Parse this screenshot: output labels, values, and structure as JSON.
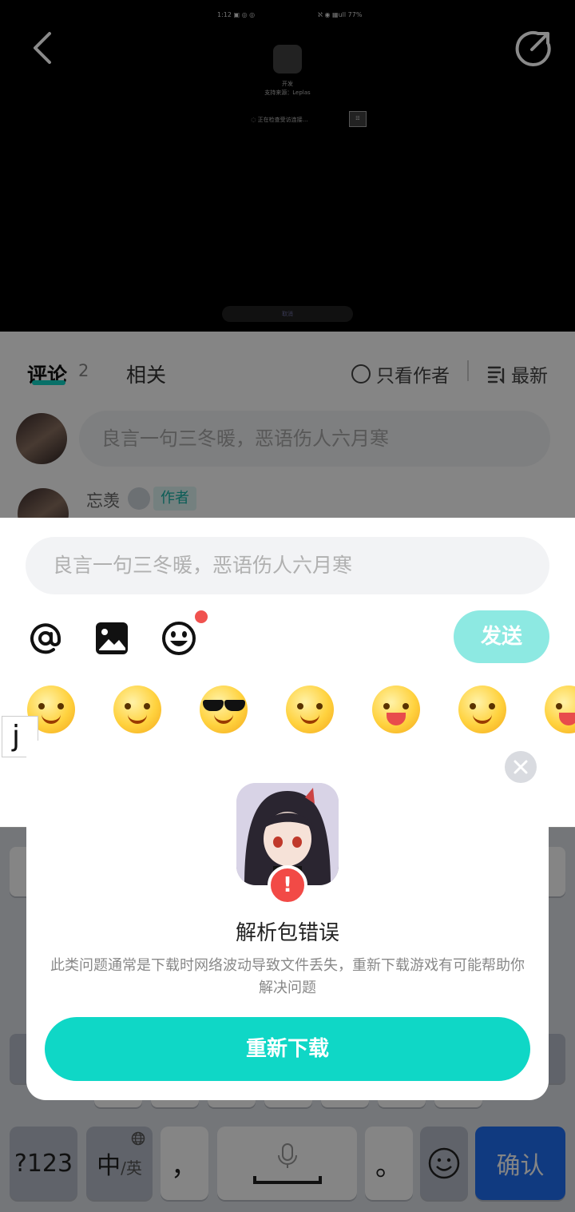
{
  "video": {
    "status_left": "1:12 ▣ ◎ ◎",
    "status_right": "ℵ ◉ ▦ull 77%",
    "mini_title": "开发",
    "mini_subtitle": "支持来源：Leplas",
    "mini_loading": "◌ 正在检查受访连接…",
    "mini_qr": "☷",
    "mini_pill": "取消"
  },
  "comments": {
    "tab_comment": "评论",
    "tab_comment_count": "2",
    "tab_related": "相关",
    "only_author": "只看作者",
    "sort": "最新",
    "input_placeholder": "良言一句三冬暖，恶语伤人六月寒",
    "first_comment_name": "忘羡",
    "first_comment_badge": "作者"
  },
  "composer": {
    "placeholder": "良言一句三冬暖，恶语伤人六月寒",
    "send": "发送",
    "stickers": [
      "wink-face",
      "blush-heart-face",
      "sunglasses-face",
      "smug-face",
      "teeth-grin-face",
      "watermelon-face",
      "tongue-face"
    ]
  },
  "keyboard": {
    "ime_text": "j",
    "key_num": "?123",
    "key_lang_main": "中",
    "key_lang_sub": "/英",
    "key_comma": "，",
    "key_period": "。",
    "key_confirm": "确认"
  },
  "dialog": {
    "title": "解析包错误",
    "description": "此类问题通常是下载时网络波动导致文件丢失，重新下载游戏有可能帮助你解决问题",
    "button": "重新下载",
    "badge": "!"
  },
  "colors": {
    "accent": "#0fd7c6",
    "send_disabled": "#8de9e2",
    "error": "#f24a46",
    "confirm_key": "#1f6ff5"
  }
}
